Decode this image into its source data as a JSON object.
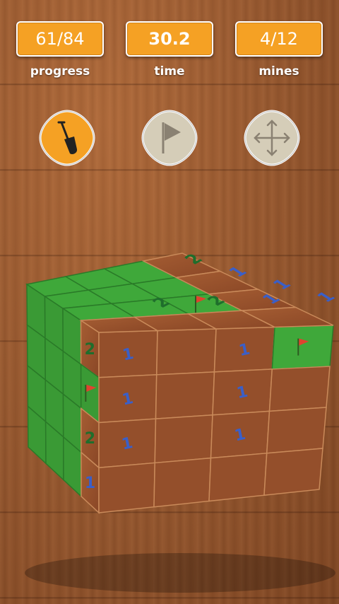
{
  "stats": {
    "progress_value": "61/84",
    "progress_label": "progress",
    "time_value": "30.2",
    "time_label": "time",
    "mines_value": "4/12",
    "mines_label": "mines"
  },
  "tools": [
    {
      "name": "dig-tool",
      "icon": "shovel-icon",
      "selected": true
    },
    {
      "name": "flag-tool",
      "icon": "flag-icon",
      "selected": false
    },
    {
      "name": "move-tool",
      "icon": "move-arrows-icon",
      "selected": false
    }
  ],
  "colors": {
    "accent": "#f5a124",
    "unrevealed": "#3fa83a",
    "revealed": "#9a5530",
    "number_one": "#3a5fc8",
    "number_two": "#1f6e2c",
    "flag": "#e0422f"
  },
  "cube": {
    "size": "4x4x4",
    "top_face": [
      [
        "hidden",
        "hidden",
        "hidden",
        "2"
      ],
      [
        "hidden",
        "hidden",
        "hidden",
        "1"
      ],
      [
        "hidden",
        "hidden",
        "flag",
        "1"
      ],
      [
        "2",
        "2",
        "1",
        "1"
      ]
    ],
    "left_face": [
      [
        "hidden",
        "hidden",
        "hidden",
        "2"
      ],
      [
        "hidden",
        "hidden",
        "hidden",
        "flag"
      ],
      [
        "hidden",
        "hidden",
        "hidden",
        "2"
      ],
      [
        "hidden",
        "hidden",
        "hidden",
        "1"
      ]
    ],
    "right_face": [
      [
        "1",
        "",
        "1",
        "flag"
      ],
      [
        "1",
        "",
        "1",
        ""
      ],
      [
        "1",
        "",
        "1",
        ""
      ],
      [
        "",
        "",
        "",
        ""
      ]
    ]
  }
}
